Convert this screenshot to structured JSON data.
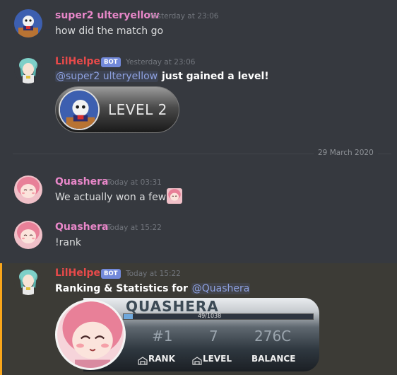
{
  "colors": {
    "background": "#36393f",
    "username_pink": "#e887c9",
    "username_bot": "#e84a4a",
    "mention": "#8ea1e1",
    "bot_badge": "#7289da",
    "highlight_bar": "#faa61a"
  },
  "messages": [
    {
      "user": "super2 ulteryellow",
      "timestamp": "Yesterday at 23:06",
      "text": "how did the match go"
    },
    {
      "user": "LilHelper",
      "badge": "BOT",
      "timestamp": "Yesterday at 23:06",
      "mention": "@super2 ulteryellow",
      "text": " just gained a level!",
      "card_text": "LEVEL 2"
    },
    {
      "user": "Quashera",
      "timestamp": "Today at 03:31",
      "text": "We actually won a few!"
    },
    {
      "user": "Quashera",
      "timestamp": "Today at 15:22",
      "text": "!rank"
    },
    {
      "user": "LilHelper",
      "badge": "BOT",
      "timestamp": "Today at 15:22",
      "text": "Ranking & Statistics for ",
      "mention": "@Quashera"
    }
  ],
  "divider": {
    "label": "29 March 2020"
  },
  "rank_card": {
    "name": "QUASHERA",
    "xp": "49/1038",
    "xp_progress": 0.047,
    "rank_value": "#1",
    "level_value": "7",
    "balance_value": "276C",
    "rank_label": "RANK",
    "level_label": "LEVEL",
    "balance_label": "BALANCE"
  }
}
